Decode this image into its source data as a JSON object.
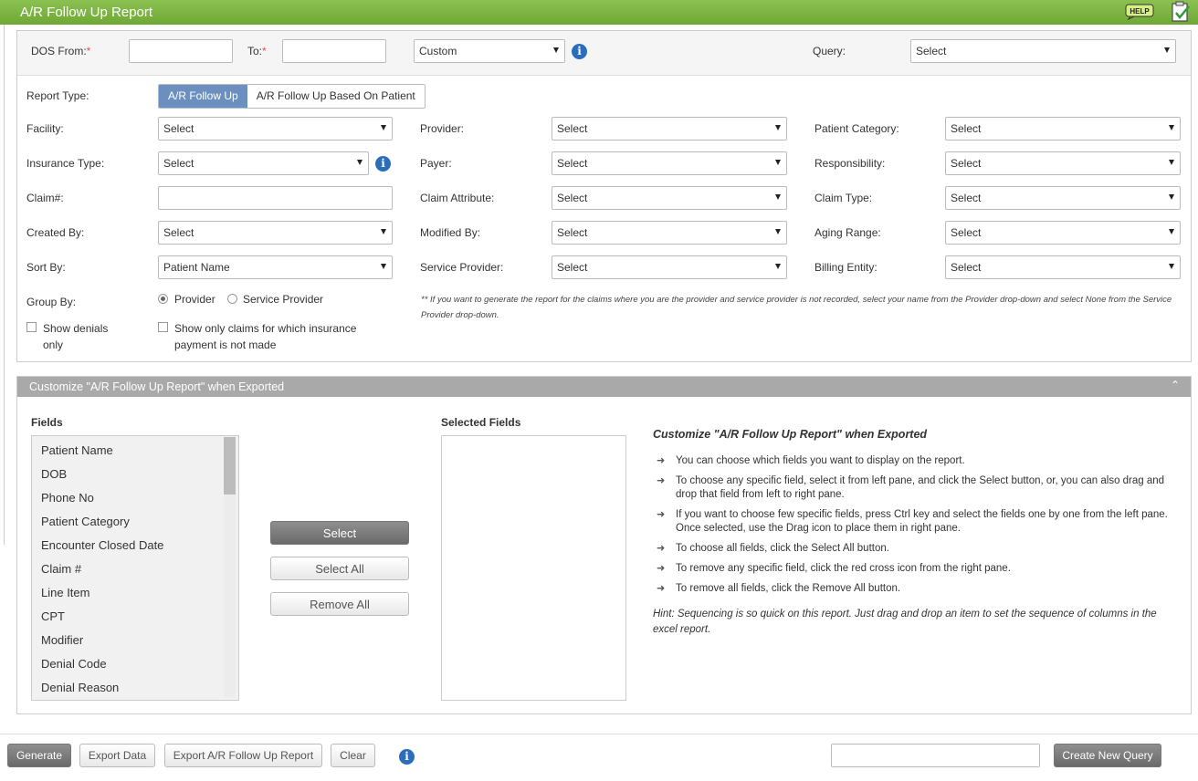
{
  "app": {
    "title": "A/R Follow Up Report",
    "help_label": "HELP"
  },
  "dos": {
    "from_label": "DOS From:",
    "to_label": "To:",
    "required_mark": "*",
    "from_value": "",
    "to_value": "",
    "range_value": "Custom"
  },
  "query": {
    "label": "Query:",
    "value": "Select"
  },
  "report_type": {
    "label": "Report Type:",
    "options": [
      "A/R Follow Up",
      "A/R Follow Up Based On Patient"
    ],
    "selected": "A/R Follow Up"
  },
  "filters": {
    "facility": {
      "label": "Facility:",
      "value": "Select"
    },
    "provider": {
      "label": "Provider:",
      "value": "Select"
    },
    "patient_category": {
      "label": "Patient Category:",
      "value": "Select"
    },
    "insurance_type": {
      "label": "Insurance Type:",
      "value": "Select"
    },
    "payer": {
      "label": "Payer:",
      "value": "Select"
    },
    "responsibility": {
      "label": "Responsibility:",
      "value": "Select"
    },
    "claim_no": {
      "label": "Claim#:",
      "value": ""
    },
    "claim_attribute": {
      "label": "Claim Attribute:",
      "value": "Select"
    },
    "claim_type": {
      "label": "Claim Type:",
      "value": "Select"
    },
    "created_by": {
      "label": "Created By:",
      "value": "Select"
    },
    "modified_by": {
      "label": "Modified By:",
      "value": "Select"
    },
    "aging_range": {
      "label": "Aging Range:",
      "value": "Select"
    },
    "sort_by": {
      "label": "Sort By:",
      "value": "Patient Name"
    },
    "service_provider": {
      "label": "Service Provider:",
      "value": "Select"
    },
    "billing_entity": {
      "label": "Billing Entity:",
      "value": "Select"
    }
  },
  "group_by": {
    "label": "Group By:",
    "options": [
      "Provider",
      "Service Provider"
    ],
    "selected": "Provider"
  },
  "checkboxes": {
    "show_denials_line1": "Show denials",
    "show_denials_line2": "only",
    "insurance_not_paid_line1": "Show only claims for which insurance",
    "insurance_not_paid_line2": "payment is not made"
  },
  "group_note": "** If you want to generate the report for the claims where you are the provider and service provider is not recorded, select your name from the Provider drop-down and select None from the Service Provider drop-down.",
  "customize": {
    "header": "Customize \"A/R Follow Up Report\" when Exported",
    "fields_label": "Fields",
    "selected_fields_label": "Selected Fields",
    "fields": [
      "Patient Name",
      "DOB",
      "Phone No",
      "Patient Category",
      "Encounter Closed Date",
      "Claim #",
      "Line Item",
      "CPT",
      "Modifier",
      "Denial Code",
      "Denial Reason"
    ],
    "buttons": {
      "select": "Select",
      "select_all": "Select All",
      "remove_all": "Remove All"
    },
    "instructions_title": "Customize \"A/R Follow Up Report\" when Exported",
    "instructions": [
      "You can choose which fields you want to display on the report.",
      "To choose any specific field, select it from left pane, and click the Select button, or, you can also drag and drop that field from left to right pane.",
      "If you want to choose few specific fields, press Ctrl key and select the fields one by one from the left pane. Once selected, use the Drag icon to place them in right pane.",
      "To choose all fields, click the Select All button.",
      "To remove any specific field, click the red cross icon from the right pane.",
      "To remove all fields, click the Remove All button."
    ],
    "hint": "Hint: Sequencing is so quick on this report. Just drag and drop an item to set the sequence of columns in the excel report."
  },
  "footer": {
    "generate": "Generate",
    "export_data": "Export Data",
    "export_report": "Export A/R Follow Up Report",
    "clear": "Clear",
    "query_name_value": "",
    "create_query": "Create New Query"
  },
  "colors": {
    "title_bar": "#7ab648",
    "toggle_active": "#6b8fbf",
    "info_icon": "#2a6ebb",
    "required": "#d9534f",
    "section_header": "#a9a9a9"
  }
}
